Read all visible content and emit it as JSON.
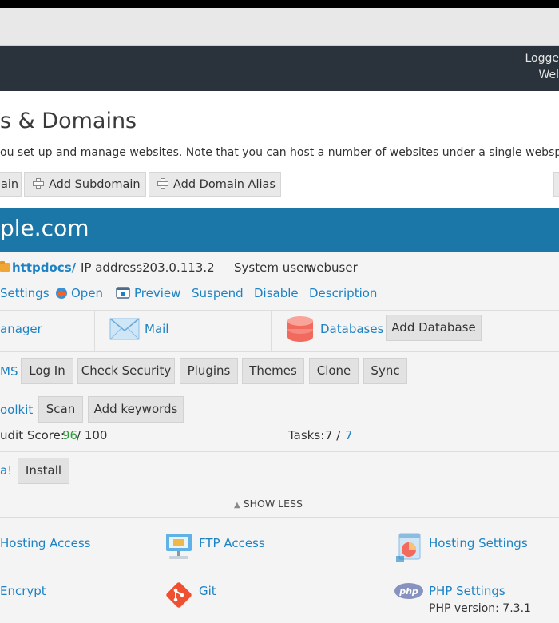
{
  "header": {
    "logged_text": "Logge",
    "webspace_text": "Wel"
  },
  "page": {
    "title": "s & Domains",
    "description": "ou set up and manage websites. Note that you can host a number of websites under a single webspace."
  },
  "toolbar": {
    "add_domain": "ain",
    "add_subdomain": "Add Subdomain",
    "add_domain_alias": "Add Domain Alias"
  },
  "domain": {
    "name": "ple.com",
    "docroot": "httpdocs/",
    "ip_label": "IP address:",
    "ip_value": "203.0.113.2",
    "sysuser_label": "System user:",
    "sysuser_value": "webuser",
    "actions": {
      "settings": "Settings",
      "open": "Open",
      "preview": "Preview",
      "suspend": "Suspend",
      "disable": "Disable",
      "description": "Description"
    },
    "file_manager": "anager",
    "mail": "Mail",
    "databases": "Databases",
    "add_database": "Add Database",
    "cms": {
      "label": "MS",
      "buttons": [
        "Log In",
        "Check Security",
        "Plugins",
        "Themes",
        "Clone",
        "Sync"
      ]
    },
    "seo": {
      "label": "oolkit",
      "scan": "Scan",
      "add_keywords": "Add keywords",
      "score_label": "udit Score:",
      "score_value": "96",
      "score_max": " / 100",
      "tasks_label": "Tasks:",
      "tasks_value": "7 /",
      "tasks_total": "7"
    },
    "install_label": "a!",
    "install_button": "Install",
    "show_less": "SHOW LESS",
    "tools": {
      "hosting_access": "Hosting Access",
      "ftp_access": "FTP Access",
      "hosting_settings": "Hosting Settings",
      "encrypt": "Encrypt",
      "git": "Git",
      "php_settings": "PHP Settings",
      "php_version": "PHP version: 7.3.1"
    }
  },
  "colors": {
    "accent_blue": "#1a77a8",
    "link": "#1d82c4",
    "score_green": "#2e9a3b"
  }
}
